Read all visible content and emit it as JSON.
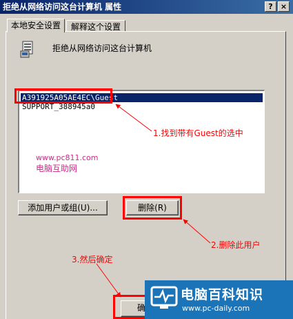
{
  "window": {
    "title": "拒绝从网络访问这台计算机 属性",
    "help_btn": "?",
    "close_btn": "×"
  },
  "tabs": [
    {
      "label": "本地安全设置"
    },
    {
      "label": "解释这个设置"
    }
  ],
  "policy": {
    "name": "拒绝从网络访问这台计算机"
  },
  "list": {
    "items": [
      {
        "text": "A391925A05AE4EC\\Guest",
        "selected": true
      },
      {
        "text": "SUPPORT_388945a0",
        "selected": false
      }
    ]
  },
  "buttons": {
    "add": "添加用户或组(U)...",
    "remove": "删除(R)",
    "ok": "确"
  },
  "watermark": {
    "url": "www.pc811.com",
    "name": "电脑互助网"
  },
  "annotations": {
    "step1": "1.找到带有Guest的选中",
    "step2": "2.删除此用户",
    "step3": "3.然后确定"
  },
  "logo": {
    "title": "电脑百科知识",
    "url": "www.pc-daily.com"
  },
  "colors": {
    "annotation": "#ff0000",
    "titlebar": "#0a246a",
    "selection": "#0a246a",
    "logo_bg": "#1b73b8"
  }
}
